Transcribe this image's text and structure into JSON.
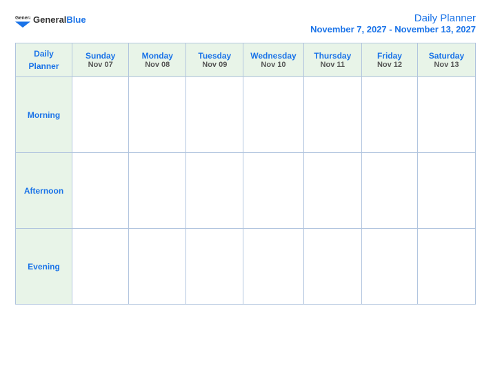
{
  "header": {
    "logo": {
      "general": "General",
      "blue": "Blue"
    },
    "title": "Daily Planner",
    "date_range": "November 7, 2027 - November 13, 2027"
  },
  "table": {
    "header_label_line1": "Daily",
    "header_label_line2": "Planner",
    "days": [
      {
        "name": "Sunday",
        "date": "Nov 07"
      },
      {
        "name": "Monday",
        "date": "Nov 08"
      },
      {
        "name": "Tuesday",
        "date": "Nov 09"
      },
      {
        "name": "Wednesday",
        "date": "Nov 10"
      },
      {
        "name": "Thursday",
        "date": "Nov 11"
      },
      {
        "name": "Friday",
        "date": "Nov 12"
      },
      {
        "name": "Saturday",
        "date": "Nov 13"
      }
    ],
    "rows": [
      {
        "label": "Morning"
      },
      {
        "label": "Afternoon"
      },
      {
        "label": "Evening"
      }
    ]
  }
}
